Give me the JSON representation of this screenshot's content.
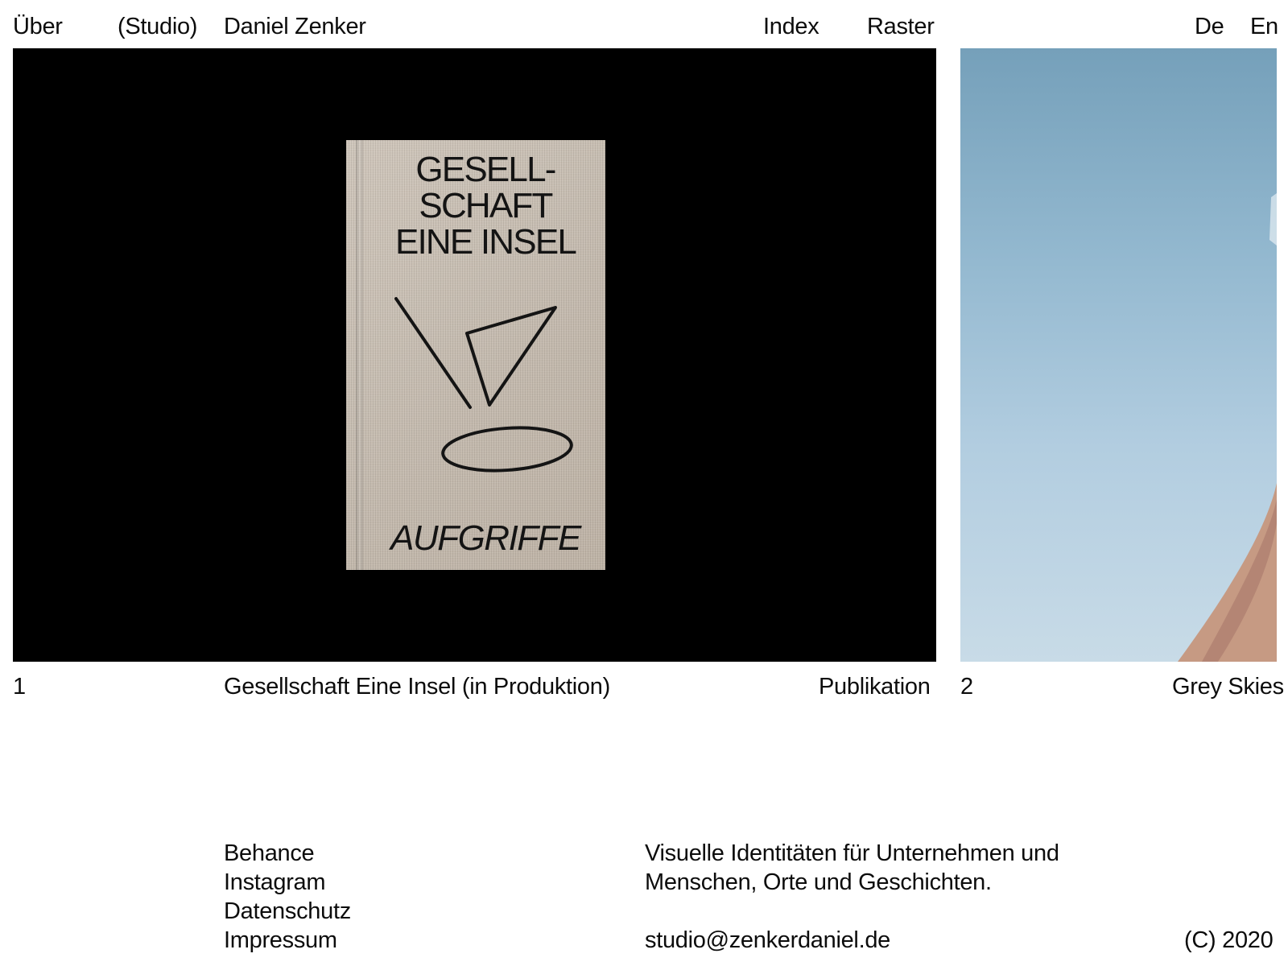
{
  "header": {
    "about": "Über",
    "studio": "(Studio)",
    "name": "Daniel Zenker",
    "index": "Index",
    "raster": "Raster",
    "languages": [
      "De",
      "En"
    ]
  },
  "projects": [
    {
      "number": "1",
      "title": "Gesellschaft Eine Insel (in Produktion)",
      "category": "Publikation",
      "image": {
        "background": "#000000",
        "book_title": "GESELL-\nSCHAFT\nEINE INSEL",
        "book_publisher": "AUFGRIFFE",
        "cover_color": "#c9bfb3"
      }
    },
    {
      "number": "2",
      "title": "Grey Skies",
      "image": {
        "sky_color_top": "#75a0ba",
        "sky_color_bottom": "#c8dbe7"
      }
    }
  ],
  "footer": {
    "links": [
      "Behance",
      "Instagram",
      "Datenschutz",
      "Impressum"
    ],
    "tagline": "Visuelle Identitäten für Unternehmen und Menschen, Orte und Geschichten.",
    "email": "studio@zenkerdaniel.de",
    "copyright": "(C) 2020"
  }
}
